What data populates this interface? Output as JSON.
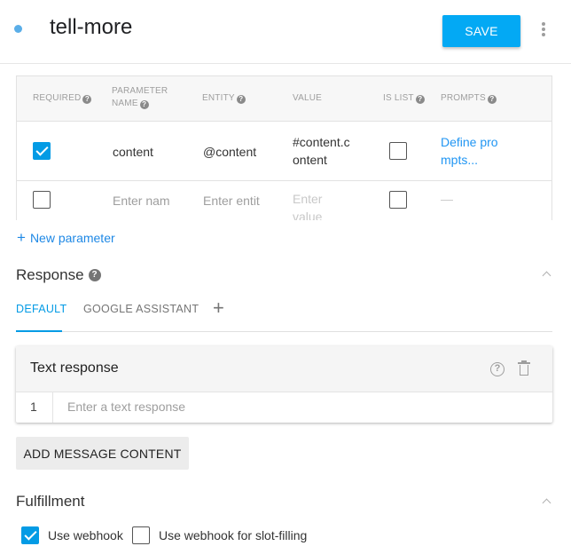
{
  "header": {
    "intent_name": "tell-more",
    "save_label": "SAVE",
    "status_color": "#5aaee8"
  },
  "parameters": {
    "columns": {
      "required": "REQUIRED",
      "param_name_1": "PARAMETER",
      "param_name_2": "NAME",
      "entity": "ENTITY",
      "value": "VALUE",
      "is_list": "IS LIST",
      "prompts": "PROMPTS"
    },
    "rows": [
      {
        "required": true,
        "name": "content",
        "entity": "@content",
        "value_line1": "#content.c",
        "value_line2": "ontent",
        "is_list": false,
        "prompts_line1": "Define pro",
        "prompts_line2": "mpts..."
      },
      {
        "required": false,
        "name_placeholder": "Enter name",
        "entity_placeholder": "Enter entity",
        "value_line1": "Enter",
        "value_line2": "value",
        "is_list": false,
        "prompts": "—"
      }
    ],
    "add_label": "New parameter"
  },
  "response": {
    "title": "Response",
    "tabs": [
      {
        "label": "DEFAULT",
        "active": true
      },
      {
        "label": "GOOGLE ASSISTANT",
        "active": false
      }
    ],
    "add_tab_symbol": "+",
    "card": {
      "title": "Text response",
      "row_number": "1",
      "placeholder": "Enter a text response"
    },
    "add_message_label": "ADD MESSAGE CONTENT"
  },
  "fulfillment": {
    "title": "Fulfillment",
    "options": [
      {
        "label": "Use webhook",
        "checked": true
      },
      {
        "label": "Use webhook for slot-filling",
        "checked": false
      }
    ]
  },
  "icons": {
    "help": "help-circle-icon",
    "delete": "trash-icon",
    "collapse": "chevron-up-icon",
    "more": "more-vert-icon"
  },
  "colors": {
    "accent": "#039be5",
    "save_button": "#03a9f4",
    "link": "#2196f3"
  }
}
